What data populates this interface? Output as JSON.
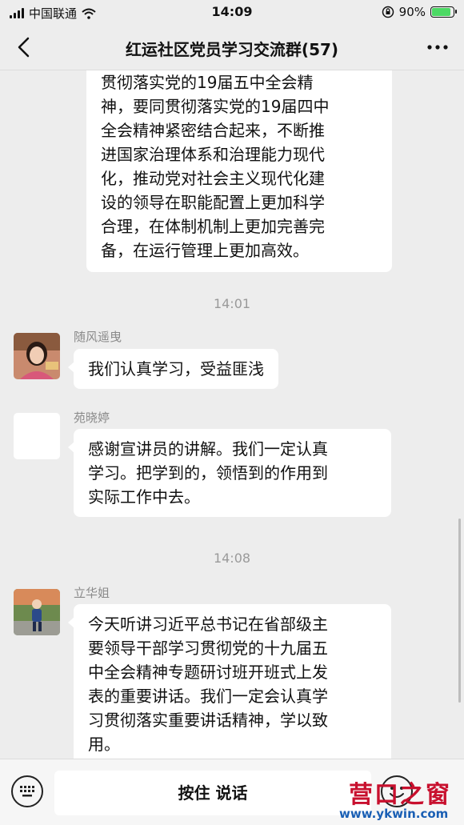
{
  "status_bar": {
    "carrier": "中国联通",
    "time": "14:09",
    "battery": "90%",
    "battery_level": 0.9,
    "icons": [
      "signal-icon",
      "wifi-icon",
      "orientation-lock-icon",
      "battery-icon"
    ]
  },
  "nav": {
    "title": "红运社区党员学习交流群(57)",
    "back_icon": "chevron-left-icon",
    "more_icon": "more-icon"
  },
  "messages": {
    "top_partial": {
      "lines": [
        "贯彻落实党的19届五中全会精",
        "神，要同贯彻落实党的19届四中",
        "全会精神紧密结合起来，不断推",
        "进国家治理体系和治理能力现代",
        "化，推动党对社会主义现代化建",
        "设的领导在职能配置上更加科学",
        "合理，在体制机制上更加完善完",
        "备，在运行管理上更加高效。"
      ]
    },
    "time_1": "14:01",
    "msg_1": {
      "sender": "随风遥曳",
      "lines": [
        "我们认真学习，受益匪浅"
      ]
    },
    "msg_2": {
      "sender": "苑晓婷",
      "lines": [
        "感谢宣讲员的讲解。我们一定认真",
        "学习。把学到的，领悟到的作用到",
        "实际工作中去。"
      ]
    },
    "time_2": "14:08",
    "msg_3": {
      "sender": "立华姐",
      "lines": [
        "今天听讲习近平总书记在省部级主",
        "要领导干部学习贯彻党的十九届五",
        "中全会精神专题研讨班开班式上发",
        "表的重要讲话。我们一定会认真学",
        "习贯彻落实重要讲话精神，学以致",
        "用。"
      ]
    }
  },
  "input_bar": {
    "talk_label": "按住 说话",
    "keyboard_icon": "keyboard-icon",
    "emoji_icon": "emoji-icon"
  },
  "watermark": {
    "title": "营口之窗",
    "url": "www.ykwin.com"
  },
  "colors": {
    "background": "#ededed",
    "bubble": "#ffffff",
    "timestamp": "#9a9a9a",
    "battery_fill": "#4cd964",
    "watermark_red": "#c8102e",
    "watermark_blue": "#1a5fb4"
  }
}
